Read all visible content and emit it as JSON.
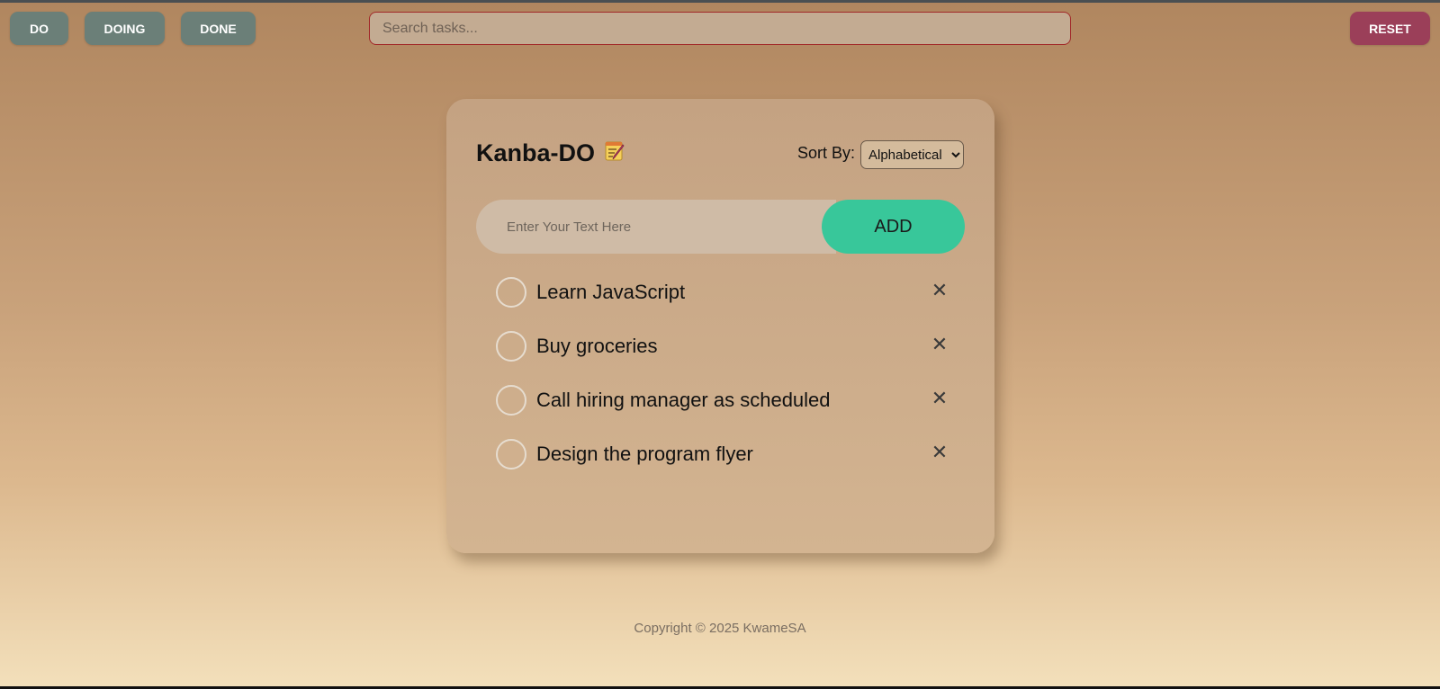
{
  "nav": {
    "do_label": "DO",
    "doing_label": "DOING",
    "done_label": "DONE",
    "reset_label": "RESET"
  },
  "search": {
    "placeholder": "Search tasks..."
  },
  "card": {
    "title": "Kanba-DO",
    "title_icon": "memo-icon",
    "sort_label": "Sort By:",
    "sort_selected": "Alphabetical",
    "input_placeholder": "Enter Your Text Here",
    "add_label": "ADD"
  },
  "tasks": [
    {
      "text": "Learn JavaScript",
      "delete_glyph": "✕"
    },
    {
      "text": "Buy groceries",
      "delete_glyph": "✕"
    },
    {
      "text": "Call hiring manager as scheduled",
      "delete_glyph": "✕"
    },
    {
      "text": "Design the program flyer",
      "delete_glyph": "✕"
    }
  ],
  "footer": {
    "copyright": "Copyright © 2025 KwameSA"
  },
  "colors": {
    "nav_button": "#6b7f78",
    "reset_button": "#9b3f59",
    "add_button": "#38c79a",
    "search_border": "#a12828"
  }
}
